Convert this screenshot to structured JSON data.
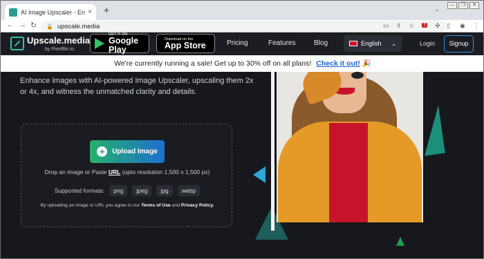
{
  "browser": {
    "tab_title": "AI Image Upscaler - Enlarge &",
    "tab_close": "×",
    "new_tab": "+",
    "url": "upscale.media",
    "window_controls": [
      "—",
      "❐",
      "✕"
    ],
    "back_icon": "←",
    "forward_icon": "→",
    "reload_icon": "↻"
  },
  "header": {
    "logo_name": "Upscale.media",
    "logo_by": "by PixelBin.io",
    "google_play_sub": "GET IT ON",
    "google_play_main": "Google Play",
    "app_store_sub": "Download on the",
    "app_store_main": "App Store",
    "apple_glyph": "",
    "menu": [
      "Pricing",
      "Features",
      "Blog"
    ],
    "language": "English",
    "language_chevron": "⌄",
    "login": "Login",
    "signup": "Signup"
  },
  "banner": {
    "text": "We're currently running a sale! Get up to 30% off on all plans!",
    "link": "Check it out!"
  },
  "main": {
    "intro": "Enhance images with AI-powered Image Upscaler, upscaling them 2x or 4x, and witness the unmatched clarity and details.",
    "upload_plus": "+",
    "upload_button": "Upload Image",
    "drop_prefix": "Drop an image or Paste",
    "drop_url": "URL",
    "drop_suffix": "(upto resolution 1,500 x 1,500 px)",
    "formats_label": "Supported formats:",
    "formats": [
      "png",
      "jpeg",
      "jpg",
      "webp"
    ],
    "terms_prefix": "By uploading an image or URL you agree to our",
    "terms_link": "Terms of Use",
    "terms_and": "and",
    "privacy_link": "Privacy Policy."
  },
  "colors": {
    "accent_green": "#25b06a",
    "accent_blue": "#1e6fd0",
    "page_bg": "#16181d"
  }
}
